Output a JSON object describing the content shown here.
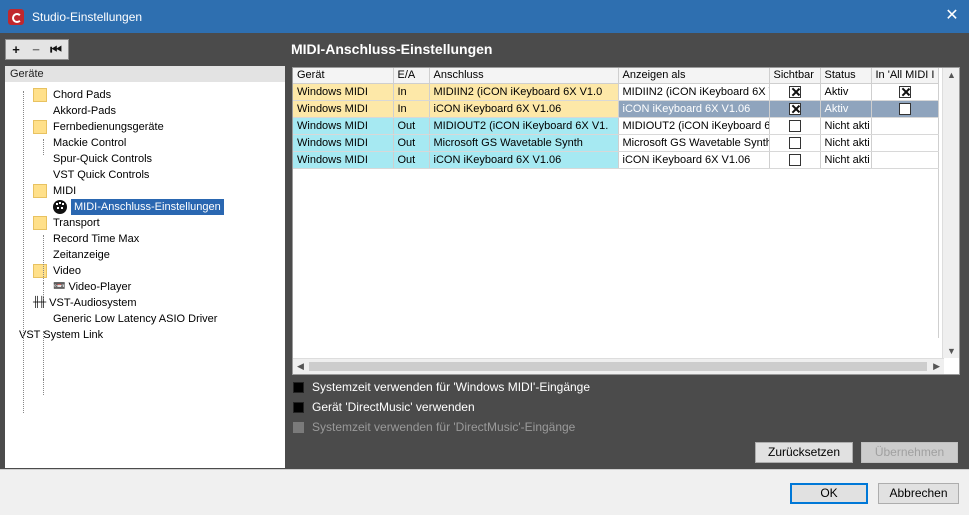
{
  "window": {
    "title": "Studio-Einstellungen"
  },
  "toolbar": {
    "add": "+",
    "remove": "−",
    "collapse": "⏮"
  },
  "tree": {
    "header": "Geräte",
    "items": [
      {
        "label": "Chord Pads",
        "kind": "folder"
      },
      {
        "label": "Akkord-Pads",
        "kind": "leaf"
      },
      {
        "label": "Fernbedienungsgeräte",
        "kind": "folder"
      },
      {
        "label": "Mackie Control",
        "kind": "leaf"
      },
      {
        "label": "Spur-Quick Controls",
        "kind": "leaf"
      },
      {
        "label": "VST Quick Controls",
        "kind": "leaf"
      },
      {
        "label": "MIDI",
        "kind": "folder"
      },
      {
        "label": "MIDI-Anschluss-Einstellungen",
        "kind": "midi-port-settings",
        "selected": true
      },
      {
        "label": "Transport",
        "kind": "folder"
      },
      {
        "label": "Record Time Max",
        "kind": "leaf"
      },
      {
        "label": "Zeitanzeige",
        "kind": "leaf"
      },
      {
        "label": "Video",
        "kind": "folder"
      },
      {
        "label": "Video-Player",
        "kind": "video-player"
      },
      {
        "label": "VST-Audiosystem",
        "kind": "audio-system"
      },
      {
        "label": "Generic Low Latency ASIO Driver",
        "kind": "leaf"
      },
      {
        "label": "VST System Link",
        "kind": "root"
      }
    ]
  },
  "panel": {
    "title": "MIDI-Anschluss-Einstellungen",
    "columns": [
      "Gerät",
      "E/A",
      "Anschluss",
      "Anzeigen als",
      "Sichtbar",
      "Status",
      "In 'All MIDI I"
    ],
    "rows": [
      {
        "device": "Windows MIDI",
        "dir": "In",
        "port": "MIDIIN2 (iCON iKeyboard 6X V1.0",
        "display": "MIDIIN2 (iCON iKeyboard 6X V",
        "visible": true,
        "status": "Aktiv",
        "all_midi": true,
        "all_midi_shown": true
      },
      {
        "device": "Windows MIDI",
        "dir": "In",
        "port": "iCON iKeyboard 6X V1.06",
        "display": "iCON iKeyboard 6X V1.06",
        "visible": true,
        "status": "Aktiv",
        "all_midi": false,
        "all_midi_shown": true,
        "selected": true
      },
      {
        "device": "Windows MIDI",
        "dir": "Out",
        "port": "MIDIOUT2 (iCON iKeyboard 6X V1.",
        "display": "MIDIOUT2 (iCON iKeyboard 6)",
        "visible": false,
        "status": "Nicht akti",
        "all_midi_shown": false
      },
      {
        "device": "Windows MIDI",
        "dir": "Out",
        "port": "Microsoft GS Wavetable Synth",
        "display": "Microsoft GS Wavetable Synth",
        "visible": false,
        "status": "Nicht akti",
        "all_midi_shown": false
      },
      {
        "device": "Windows MIDI",
        "dir": "Out",
        "port": "iCON iKeyboard 6X V1.06",
        "display": "iCON iKeyboard 6X V1.06",
        "visible": false,
        "status": "Nicht akti",
        "all_midi_shown": false
      }
    ],
    "options": [
      {
        "label": "Systemzeit verwenden für 'Windows MIDI'-Eingänge",
        "enabled": true
      },
      {
        "label": "Gerät 'DirectMusic' verwenden",
        "enabled": true
      },
      {
        "label": "Systemzeit verwenden für 'DirectMusic'-Eingänge",
        "enabled": false
      }
    ],
    "reset_label": "Zurücksetzen",
    "apply_label": "Übernehmen"
  },
  "footer": {
    "ok_label": "OK",
    "cancel_label": "Abbrechen"
  },
  "colors": {
    "title_bar": "#2e6fb0",
    "in_row": "#fde8a8",
    "out_row": "#a6e9f2",
    "selection": "#2a67b1"
  }
}
